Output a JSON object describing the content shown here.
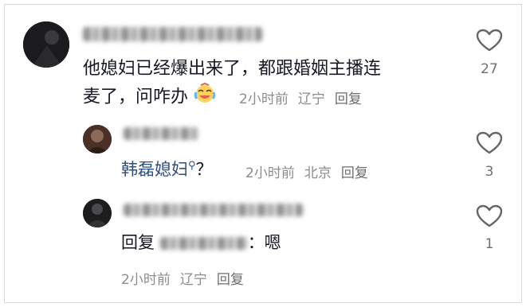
{
  "comments": [
    {
      "text": "他媳妇已经爆出来了，都跟婚姻主播连麦了，问咋办",
      "line1": "他媳妇已经爆出来了，都跟婚姻主播连",
      "line2": "麦了，问咋办",
      "emoji_icon": "crying-laughing-emoji-icon",
      "time": "2小时前",
      "location": "辽宁",
      "reply_label": "回复",
      "likes": "27"
    },
    {
      "mention": "韩磊媳妇",
      "search_icon": "search-icon",
      "suffix": "？",
      "time": "2小时前",
      "location": "北京",
      "reply_label": "回复",
      "likes": "3"
    },
    {
      "prefix": "回复",
      "suffix": "：嗯",
      "time": "2小时前",
      "location": "辽宁",
      "reply_label": "回复",
      "likes": "1"
    }
  ],
  "colors": {
    "accent": "#2f4f83",
    "meta": "#8c8c8c",
    "text": "#161823"
  }
}
